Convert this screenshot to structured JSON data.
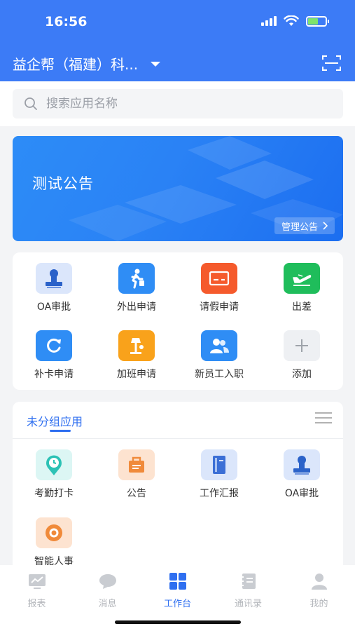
{
  "status": {
    "time": "16:56"
  },
  "header": {
    "company": "益企帮（福建）科...",
    "scan_icon": "scan-icon"
  },
  "search": {
    "placeholder": "搜索应用名称"
  },
  "banner": {
    "title": "测试公告",
    "manage_label": "管理公告"
  },
  "shortcuts": [
    {
      "label": "OA审批",
      "icon": "stamp-icon",
      "color": "#dbe6fb"
    },
    {
      "label": "外出申请",
      "icon": "walking-person-icon",
      "color": "#2f8df5"
    },
    {
      "label": "请假申请",
      "icon": "card-icon",
      "color": "#f55a2c"
    },
    {
      "label": "出差",
      "icon": "airplane-icon",
      "color": "#1fbd5b"
    },
    {
      "label": "补卡申请",
      "icon": "refresh-icon",
      "color": "#2f8df5"
    },
    {
      "label": "加班申请",
      "icon": "desk-lamp-icon",
      "color": "#f9a21b"
    },
    {
      "label": "新员工入职",
      "icon": "users-icon",
      "color": "#2f8df5"
    },
    {
      "label": "添加",
      "icon": "plus-icon",
      "color": "#eef0f3"
    }
  ],
  "group": {
    "title": "未分组应用",
    "apps": [
      {
        "label": "考勤打卡",
        "icon": "clock-pin-icon"
      },
      {
        "label": "公告",
        "icon": "bag-icon"
      },
      {
        "label": "工作汇报",
        "icon": "notebook-icon"
      },
      {
        "label": "OA审批",
        "icon": "stamp-icon"
      },
      {
        "label": "智能人事",
        "icon": "target-icon"
      }
    ]
  },
  "tabs": [
    {
      "label": "报表",
      "icon": "report-icon",
      "active": false
    },
    {
      "label": "消息",
      "icon": "message-icon",
      "active": false
    },
    {
      "label": "工作台",
      "icon": "grid-icon",
      "active": true
    },
    {
      "label": "通讯录",
      "icon": "contacts-icon",
      "active": false
    },
    {
      "label": "我的",
      "icon": "profile-icon",
      "active": false
    }
  ],
  "colors": {
    "primary": "#3c7bf6",
    "accent": "#2f6ff0"
  }
}
